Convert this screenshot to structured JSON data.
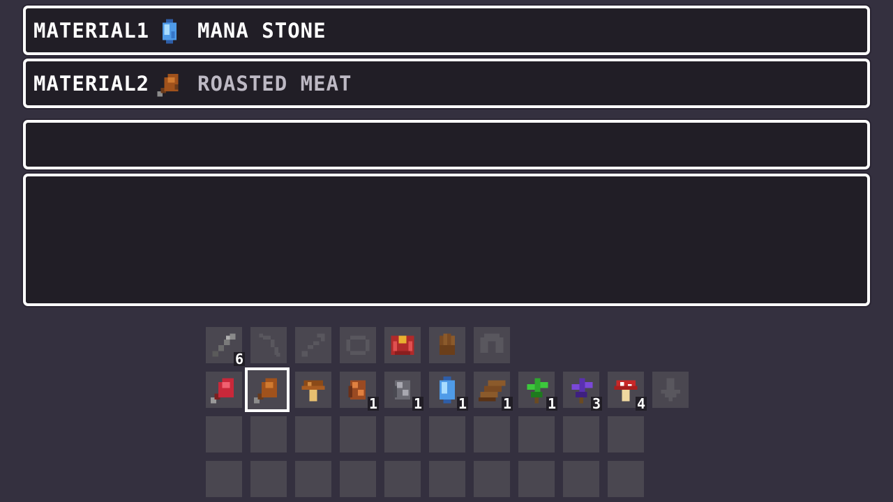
{
  "craft": {
    "material1": {
      "label": "MATERIAL1",
      "icon": "mana-stone-icon",
      "name": "MANA STONE"
    },
    "material2": {
      "label": "MATERIAL2",
      "icon": "roasted-meat-icon",
      "name": "ROASTED MEAT"
    }
  },
  "equipment": [
    {
      "icon": "sword-icon",
      "count": "6"
    },
    {
      "icon": "bow-icon",
      "count": ""
    },
    {
      "icon": "arrow-icon",
      "count": ""
    },
    {
      "icon": "ring-icon",
      "count": ""
    },
    {
      "icon": "armor-icon",
      "count": ""
    },
    {
      "icon": "glove-icon",
      "count": ""
    },
    {
      "icon": "helmet-icon",
      "count": ""
    }
  ],
  "hotbar": [
    {
      "icon": "raw-meat-icon",
      "count": ""
    },
    {
      "icon": "roasted-meat-icon",
      "count": ""
    },
    {
      "icon": "brown-mushroom-icon",
      "count": ""
    },
    {
      "icon": "copper-ore-icon",
      "count": "1"
    },
    {
      "icon": "iron-ore-icon",
      "count": "1"
    },
    {
      "icon": "mana-stone-icon",
      "count": "1"
    },
    {
      "icon": "wood-plank-icon",
      "count": "1"
    },
    {
      "icon": "green-herb-icon",
      "count": "1"
    },
    {
      "icon": "purple-herb-icon",
      "count": "3"
    },
    {
      "icon": "red-mushroom-icon",
      "count": "4"
    },
    {
      "icon": "down-arrow-icon",
      "count": ""
    }
  ],
  "colors": {
    "background": "#34303f",
    "panel": "#211e26",
    "slot": "#4a4750",
    "border": "#ffffff"
  }
}
